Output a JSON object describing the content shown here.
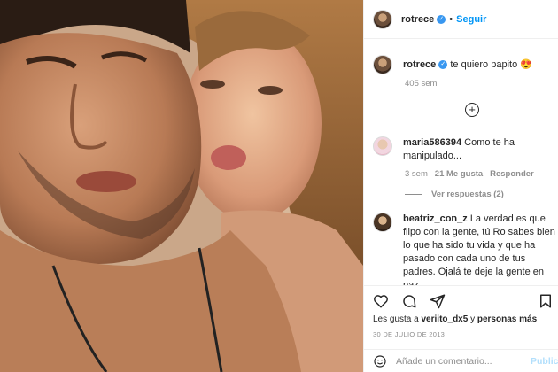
{
  "post": {
    "username": "rotrece",
    "follow_label": "Seguir",
    "dot": "•"
  },
  "caption": {
    "username": "rotrece",
    "text": "te quiero papito 😍",
    "age": "405 sem"
  },
  "comments": [
    {
      "username": "maria586394",
      "text": "Como te ha manipulado...",
      "age": "3 sem",
      "likes": "21 Me gusta",
      "reply": "Responder",
      "view_replies": "Ver respuestas (2)"
    },
    {
      "username": "beatriz_con_z",
      "text": "La verdad es que flipo con la gente, tú Ro sabes bien lo que ha sido tu vida y que ha pasado con cada uno de tus padres. Ojalá te deje la gente en paz."
    }
  ],
  "likes_line": {
    "prefix": "Les gusta a",
    "user": "veriito_dx5",
    "middle": "y",
    "others": "personas más"
  },
  "date": "30 DE JULIO DE 2013",
  "add_comment": {
    "placeholder": "Añade un comentario...",
    "publish_label": "Publica"
  },
  "icons": {
    "verified": "verified-badge-icon",
    "load_more": "plus-circle-icon",
    "like": "heart-icon",
    "comment": "comment-icon",
    "share": "share-icon",
    "save": "bookmark-icon",
    "emoji": "smiley-icon"
  },
  "colors": {
    "accent": "#0095f6",
    "verified": "#3897f0",
    "muted": "#8e8e8e",
    "publish_disabled": "#b2dffc"
  }
}
